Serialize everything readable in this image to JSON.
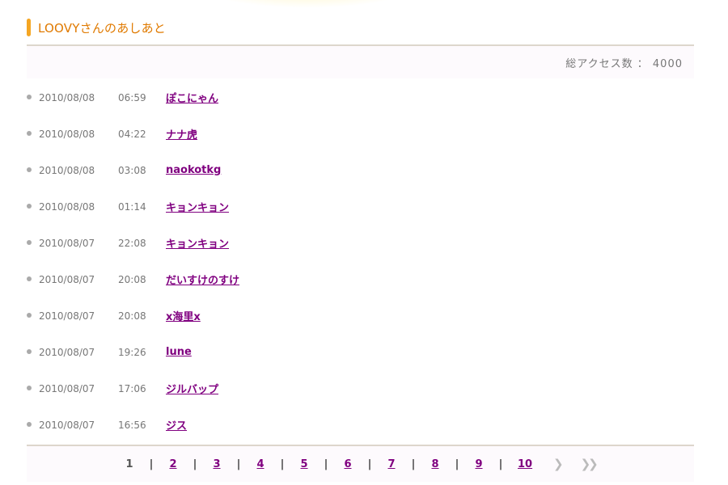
{
  "header": {
    "title": "LOOVYさんのあしあと",
    "accent_color": "#f5a623",
    "title_color": "#e07a00"
  },
  "summary": {
    "total_access": "総アクセス数 ： 4000"
  },
  "visits": [
    {
      "date": "2010/08/08",
      "time": "06:59",
      "name": "ぽこにゃん"
    },
    {
      "date": "2010/08/08",
      "time": "04:22",
      "name": "ナナ虎"
    },
    {
      "date": "2010/08/08",
      "time": "03:08",
      "name": "naokotkg"
    },
    {
      "date": "2010/08/08",
      "time": "01:14",
      "name": "キョンキョン"
    },
    {
      "date": "2010/08/07",
      "time": "22:08",
      "name": "キョンキョン"
    },
    {
      "date": "2010/08/07",
      "time": "20:08",
      "name": "だいすけのすけ"
    },
    {
      "date": "2010/08/07",
      "time": "20:08",
      "name": "x海里x"
    },
    {
      "date": "2010/08/07",
      "time": "19:26",
      "name": "lune"
    },
    {
      "date": "2010/08/07",
      "time": "17:06",
      "name": "ジルバップ"
    },
    {
      "date": "2010/08/07",
      "time": "16:56",
      "name": "ジス"
    }
  ],
  "pagination": {
    "current": "1",
    "separator": "|",
    "pages": [
      "2",
      "3",
      "4",
      "5",
      "6",
      "7",
      "8",
      "9",
      "10"
    ],
    "next_icon": "chevron-right-icon",
    "last_icon": "double-chevron-right-icon",
    "link_color": "#800080"
  }
}
